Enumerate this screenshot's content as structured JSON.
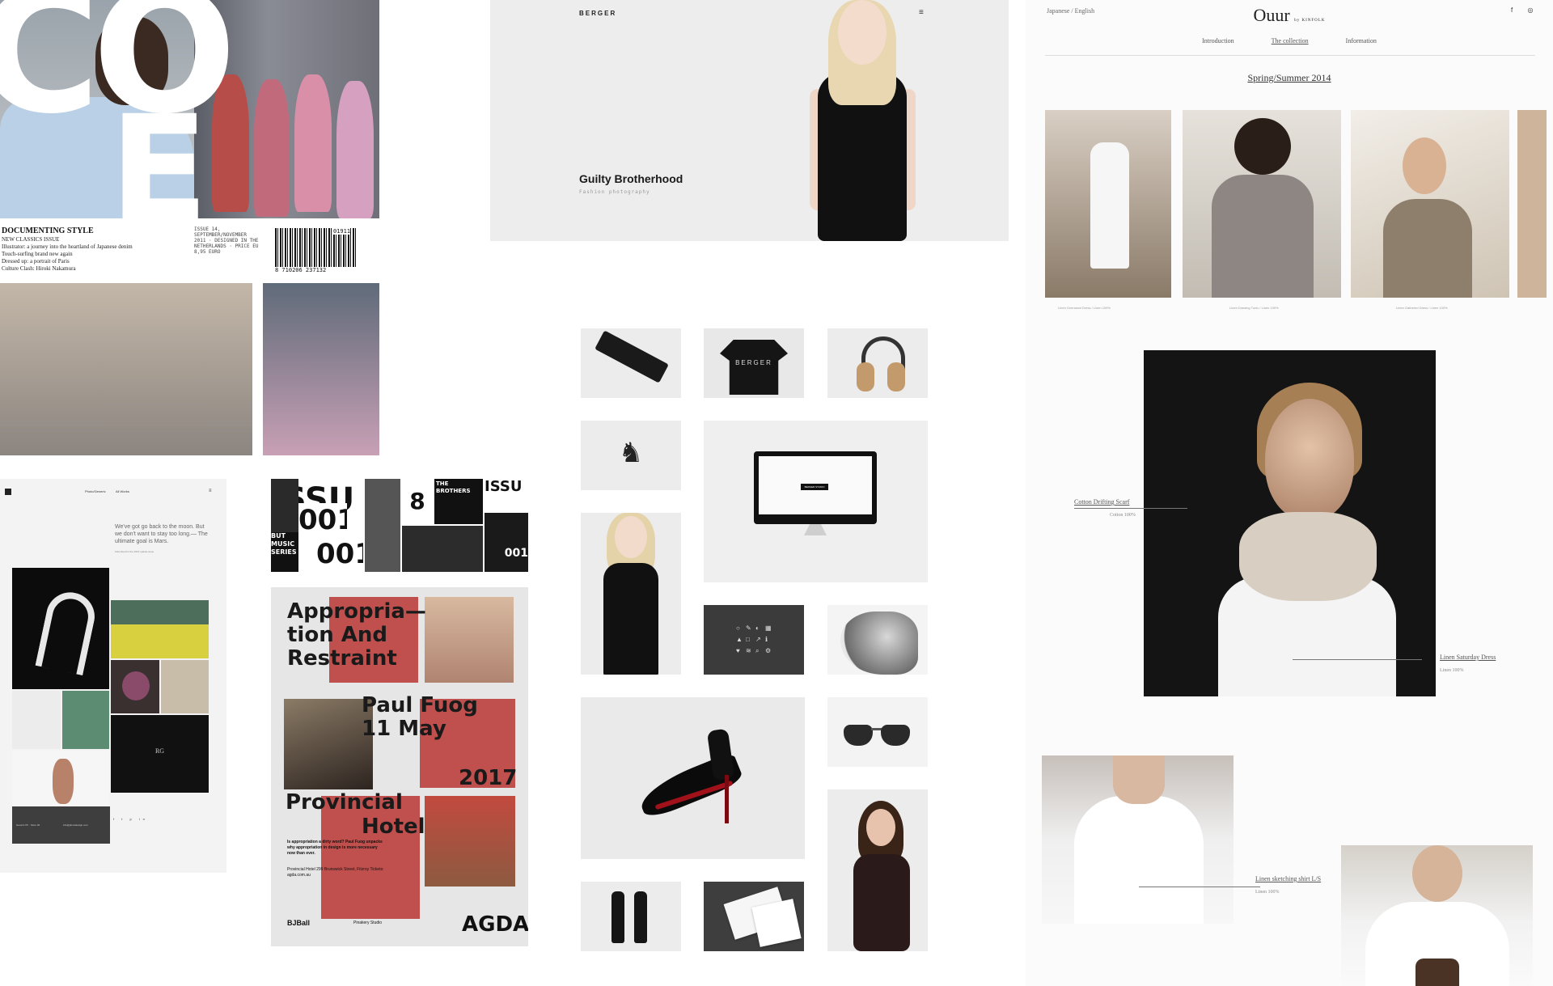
{
  "magazine": {
    "logo_c": "CO",
    "logo_e": "E",
    "headline": "DOCUMENTING STYLE",
    "lines": [
      "NEW CLASSICS ISSUE",
      "Illustrator: a journey into the heartland of Japanese denim",
      "Touch-surfing brand new again",
      "Dressed up: a portrait of Paris",
      "Culture Clash: Hiroki Nakamura"
    ],
    "issue_text": "ISSUE 14, SEPTEMBER/NOVEMBER 2011 · DESIGNED IN THE NETHERLANDS · PRICE EU 8,95 EURO",
    "barcode_number": "8 710206 237132",
    "barcode_suffix": "01911"
  },
  "berger_hero": {
    "brand": "BERGER",
    "title": "Guilty Brotherhood",
    "subtitle": "Fashion photography",
    "menu_icon": "≡"
  },
  "product_grid": {
    "shirt_label": "BERGER",
    "imac_badge": "BERGER STUDIO",
    "deer_symbol": "♞"
  },
  "portfolio": {
    "nav": [
      "Photo/Generic",
      "All Works"
    ],
    "quote": "We've got go back to the moon. But we don't want to stay too long.— The ultimate goal is Mars.",
    "small": "Submitted for the 2015 update issue",
    "footer": [
      "Generic PF · Store 20",
      "info@photodesign.com"
    ],
    "social": "f t p in",
    "tile_badge": "RG"
  },
  "issue_strip": {
    "cells": [
      "ISSU",
      "001",
      "001",
      "8",
      "THE BROTHERS",
      "ISSU",
      "001",
      "BUT MUSIC SERIES"
    ]
  },
  "agda": {
    "title": "Appropria— tion And Restraint",
    "speaker": "Paul Fuog 11 May",
    "year": "2017",
    "venue_1": "Provincial",
    "venue_2": "Hotel",
    "body": "Is appropriation a dirty word? Paul Fuog unpacks why appropriation in design is more necessary now than ever.",
    "address": "Provincial Hotel 299 Brunswick Street, Fitzroy Tickets: agda.com.au",
    "sponsor_1": "BJBall",
    "sponsor_2": "Pinakery Studio",
    "wordmark": "AGDA"
  },
  "ouur": {
    "lang": "Japanese  /  English",
    "logo": "Ouur",
    "logo_suffix": "by KINFOLK",
    "nav": [
      "Introduction",
      "The collection",
      "Information"
    ],
    "season": "Spring/Summer 2014",
    "photo_captions": [
      "Linen Oversized Dress / Linen 100%",
      "Linen Drawing Tunic / Linen 100%",
      "Linen Gathered Dress / Linen 100%"
    ],
    "labels": [
      {
        "title": "Cotton Drifting Scarf",
        "sub": "Cotton 100%"
      },
      {
        "title": "Linen Saturday Dress",
        "sub": "Linen 100%"
      },
      {
        "title": "Linen sketching shirt L/S",
        "sub": "Linen 100%"
      }
    ],
    "social": "f ◎"
  },
  "palette": {
    "agda_red": "#c0504d",
    "page_bg": "#ffffff",
    "dark": "#111111"
  }
}
